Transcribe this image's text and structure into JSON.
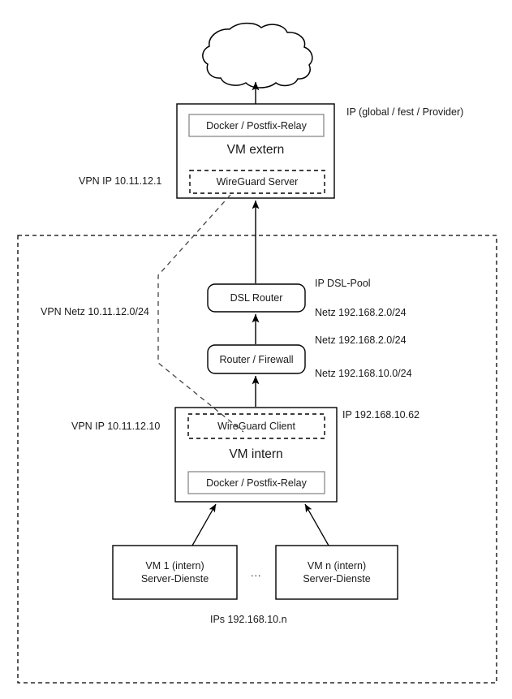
{
  "diagram": {
    "title": "WireGuard VPN network topology",
    "colors": {
      "stroke": "#000000",
      "inner_stroke": "#666666",
      "text": "#1a1a1a",
      "background": "#ffffff"
    },
    "cloud": {
      "name": "internet-cloud",
      "label": ""
    },
    "vm_extern": {
      "title": "VM extern",
      "service_box": "Docker / Postfix-Relay",
      "vpn_box": "WireGuard Server",
      "left_label": "VPN IP 10.11.12.1",
      "right_label": "IP (global / fest / Provider)"
    },
    "dsl_router": {
      "title": "DSL Router",
      "right_label_top": "IP DSL-Pool",
      "right_label_bottom": "Netz 192.168.2.0/24"
    },
    "router_firewall": {
      "title": "Router / Firewall",
      "right_label_top": "Netz 192.168.2.0/24",
      "right_label_bottom": "Netz 192.168.10.0/24"
    },
    "vm_intern": {
      "title": "VM intern",
      "service_box": "Docker / Postfix-Relay",
      "vpn_box": "WireGuard Client",
      "left_label": "VPN IP 10.11.12.10",
      "right_label": "IP 192.168.10.62"
    },
    "vpn_net_label": "VPN Netz 10.11.12.0/24",
    "internal_vms": [
      {
        "line1": "VM 1 (intern)",
        "line2": "Server-Dienste"
      },
      {
        "line1": "VM n (intern)",
        "line2": "Server-Dienste"
      }
    ],
    "ellipsis": "...",
    "internal_vms_ip_label": "IPs 192.168.10.n"
  }
}
